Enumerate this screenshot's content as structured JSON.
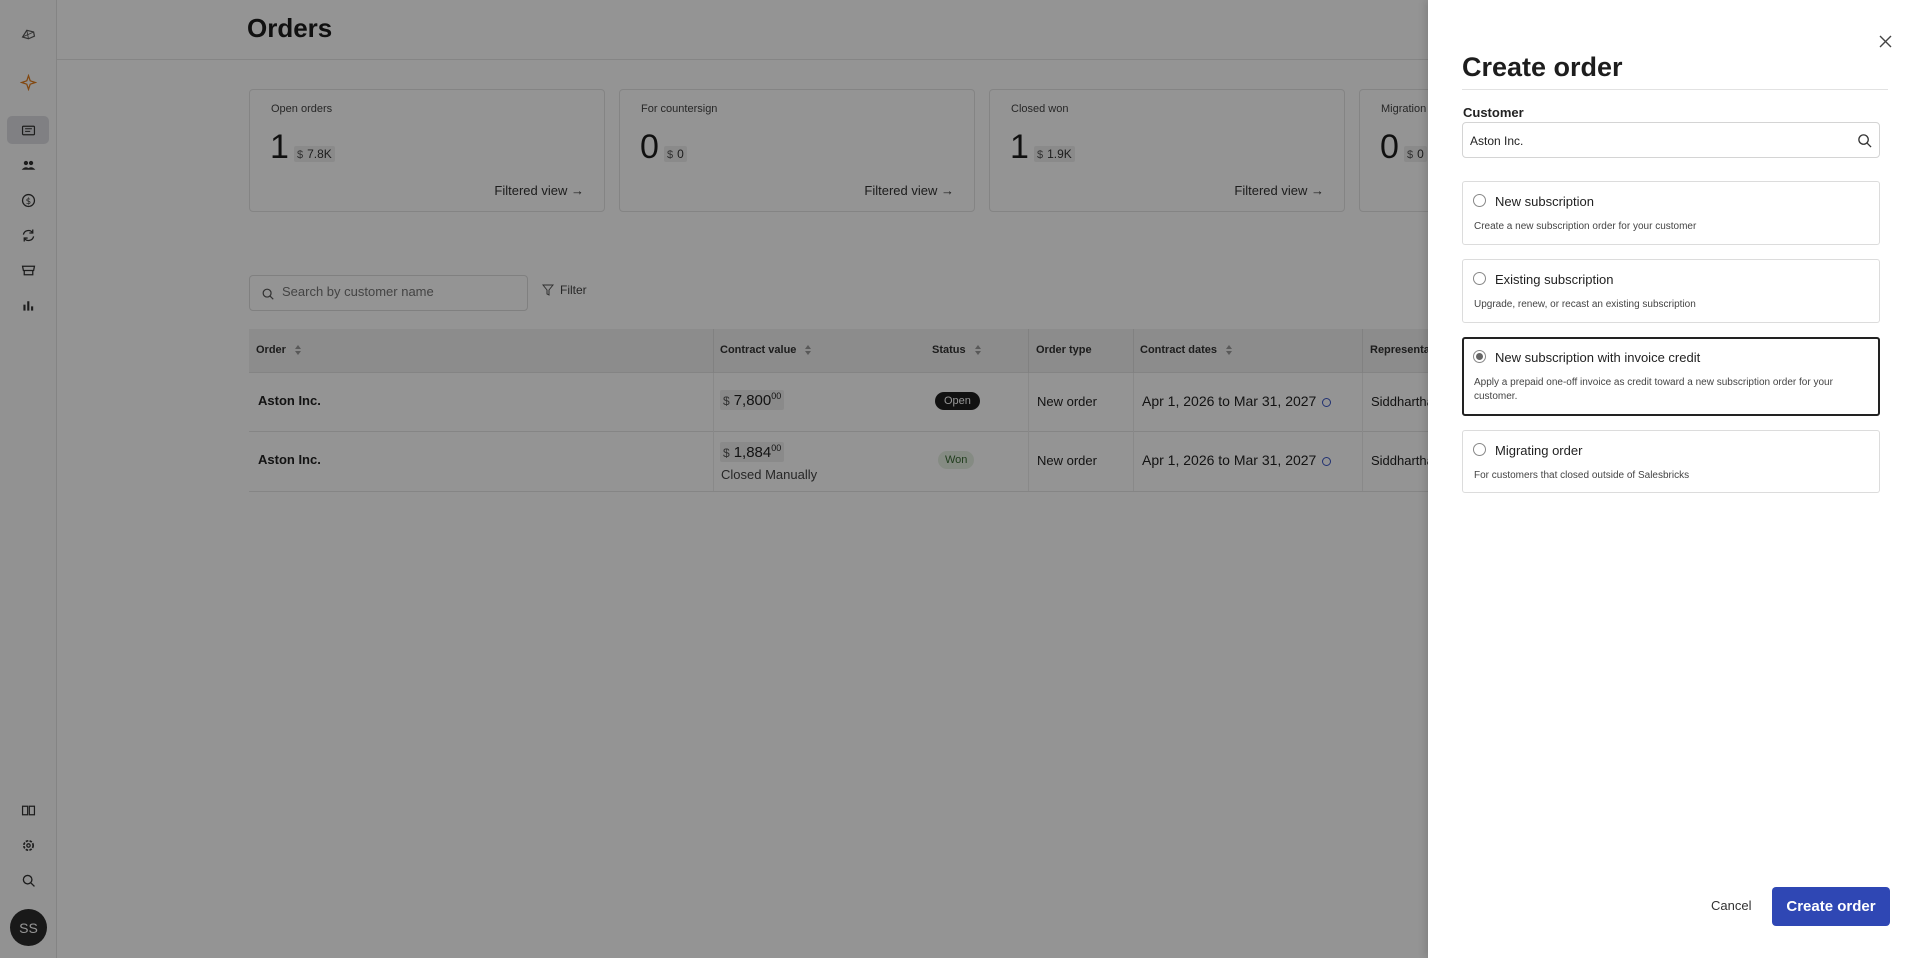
{
  "sidebar": {
    "icons": [
      "logo-icon",
      "sparkle-icon",
      "orders-icon",
      "customers-icon",
      "dollar-icon",
      "refresh-icon",
      "store-icon",
      "chart-icon",
      "book-icon",
      "gear-icon",
      "search-icon"
    ],
    "avatar_initials": "SS"
  },
  "page": {
    "title": "Orders"
  },
  "cards": [
    {
      "title": "Open orders",
      "count": "1",
      "currency": "$",
      "amount": "7.8K",
      "link": "Filtered view →"
    },
    {
      "title": "For countersign",
      "count": "0",
      "currency": "$",
      "amount": "0",
      "link": "Filtered view →"
    },
    {
      "title": "Closed won",
      "count": "1",
      "currency": "$",
      "amount": "1.9K",
      "link": "Filtered view →"
    },
    {
      "title": "Migration",
      "count": "0",
      "currency": "$",
      "amount": "0",
      "link": ""
    }
  ],
  "toolbar": {
    "search_placeholder": "Search by customer name",
    "filter_label": "Filter"
  },
  "table": {
    "columns": [
      "Order",
      "Contract value",
      "Status",
      "Order type",
      "Contract dates",
      "Representative"
    ],
    "rows": [
      {
        "order": "Aston Inc.",
        "currency": "$",
        "value": "7,800",
        "cents": "00",
        "note": "",
        "status": "Open",
        "order_type": "New order",
        "dates": "Apr 1, 2026 to Mar 31, 2027",
        "rep": "Siddhartha Sum"
      },
      {
        "order": "Aston Inc.",
        "currency": "$",
        "value": "1,884",
        "cents": "00",
        "note": "Closed Manually",
        "status": "Won",
        "order_type": "New order",
        "dates": "Apr 1, 2026 to Mar 31, 2027",
        "rep": "Siddhartha Sum"
      }
    ]
  },
  "panel": {
    "title": "Create order",
    "customer_label": "Customer",
    "customer_value": "Aston Inc.",
    "options": [
      {
        "title": "New subscription",
        "desc": "Create a new subscription order for your customer",
        "selected": false
      },
      {
        "title": "Existing subscription",
        "desc": "Upgrade, renew, or recast an existing subscription",
        "selected": false
      },
      {
        "title": "New subscription with invoice credit",
        "desc": "Apply a prepaid one-off invoice as credit toward a new subscription order for your customer.",
        "selected": true
      },
      {
        "title": "Migrating order",
        "desc": "For customers that closed outside of Salesbricks",
        "selected": false
      }
    ],
    "cancel_label": "Cancel",
    "create_label": "Create order"
  },
  "colors": {
    "accent": "#2f47b4",
    "overlay": "rgba(0,0,0,0.42)",
    "status_open": "#1e1e1e",
    "status_won": "#e6efe2"
  }
}
